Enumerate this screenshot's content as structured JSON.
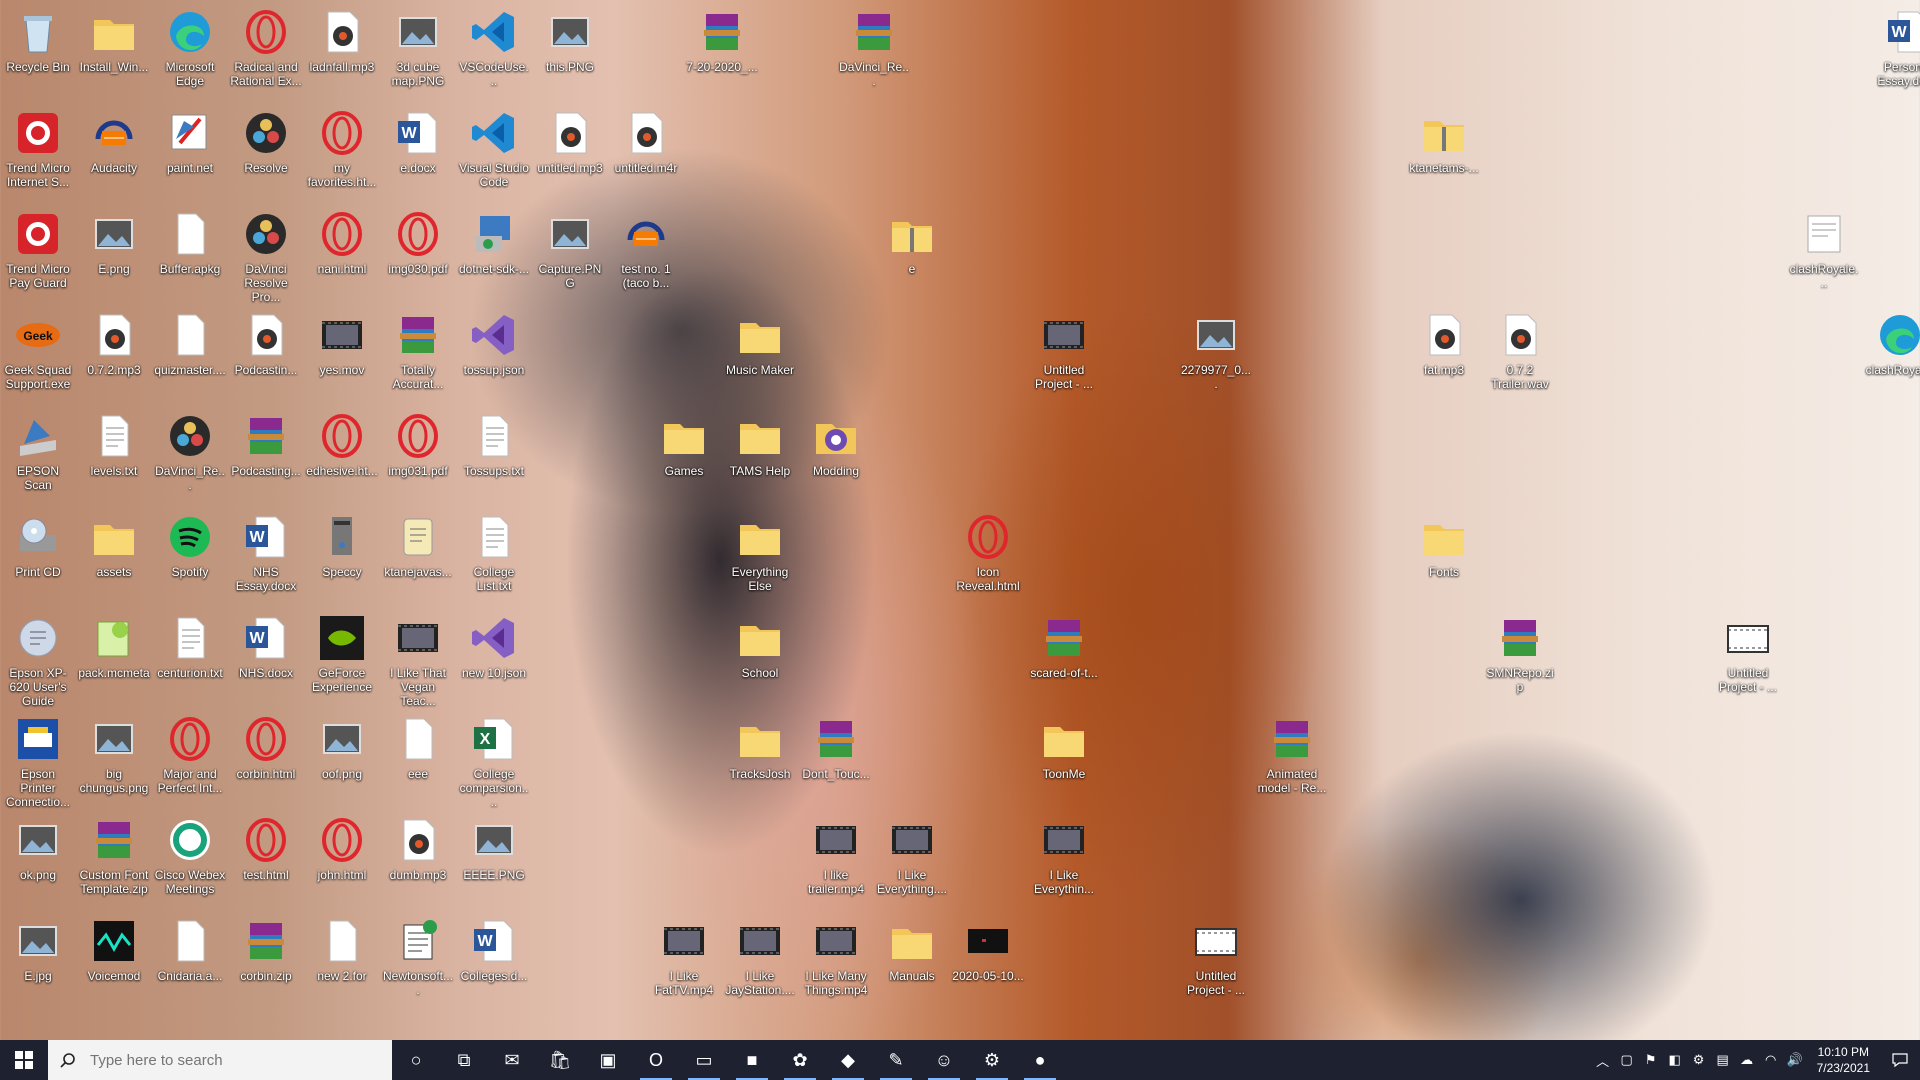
{
  "desktop_icons": [
    {
      "label": "Recycle Bin",
      "icon": "recycle-bin-icon",
      "type": "bin"
    },
    {
      "label": "Install_Win...",
      "icon": "folder-icon",
      "type": "folder"
    },
    {
      "label": "Microsoft Edge",
      "icon": "edge-icon",
      "type": "edge"
    },
    {
      "label": "Radical and Rational Ex...",
      "icon": "opera-icon",
      "type": "opera"
    },
    {
      "label": "ladnfall.mp3",
      "icon": "audio-file-icon",
      "type": "audio"
    },
    {
      "label": "3d cube map.PNG",
      "icon": "image-file-icon",
      "type": "image"
    },
    {
      "label": "VSCodeUse...",
      "icon": "vscode-icon",
      "type": "vscode"
    },
    {
      "label": "this.PNG",
      "icon": "image-file-icon",
      "type": "image"
    },
    {
      "label": "7-20-2020_...",
      "icon": "winrar-archive-icon",
      "type": "rar"
    },
    {
      "label": "DaVinci_Re...",
      "icon": "winrar-archive-icon",
      "type": "rar"
    },
    {
      "label": "Personal Essay.docx",
      "icon": "word-doc-icon",
      "type": "word"
    },
    {
      "label": "Trend Micro Internet S...",
      "icon": "trend-micro-icon",
      "type": "trend"
    },
    {
      "label": "Audacity",
      "icon": "audacity-icon",
      "type": "audacity"
    },
    {
      "label": "paint.net",
      "icon": "paint-net-icon",
      "type": "paint"
    },
    {
      "label": "Resolve",
      "icon": "davinci-resolve-icon",
      "type": "resolve"
    },
    {
      "label": "my favorites.ht...",
      "icon": "opera-icon",
      "type": "opera"
    },
    {
      "label": "e.docx",
      "icon": "word-doc-icon",
      "type": "word"
    },
    {
      "label": "Visual Studio Code",
      "icon": "vscode-icon",
      "type": "vscode"
    },
    {
      "label": "untitled.mp3",
      "icon": "audio-file-icon",
      "type": "audio"
    },
    {
      "label": "untitled.m4r",
      "icon": "audio-file-icon",
      "type": "audio"
    },
    {
      "label": "ktanetams-...",
      "icon": "zip-folder-icon",
      "type": "zipfolder"
    },
    {
      "label": "Trend Micro Pay Guard",
      "icon": "trend-micro-icon",
      "type": "trend"
    },
    {
      "label": "E.png",
      "icon": "image-file-icon",
      "type": "image"
    },
    {
      "label": "Buffer.apkg",
      "icon": "blank-file-icon",
      "type": "blank"
    },
    {
      "label": "DaVinci Resolve Pro...",
      "icon": "davinci-resolve-icon",
      "type": "resolve"
    },
    {
      "label": "nani.html",
      "icon": "opera-icon",
      "type": "opera"
    },
    {
      "label": "img030.pdf",
      "icon": "opera-icon",
      "type": "opera"
    },
    {
      "label": "dotnet-sdk-...",
      "icon": "installer-icon",
      "type": "installer"
    },
    {
      "label": "Capture.PNG",
      "icon": "image-file-icon",
      "type": "image"
    },
    {
      "label": "test no. 1 (taco b...",
      "icon": "audacity-icon",
      "type": "audacity"
    },
    {
      "label": "e",
      "icon": "zip-folder-icon",
      "type": "zipfolder"
    },
    {
      "label": "clashRoyale...",
      "icon": "document-icon",
      "type": "doc"
    },
    {
      "label": "Geek Squad Support.exe",
      "icon": "geek-squad-icon",
      "type": "geek"
    },
    {
      "label": "0.7.2.mp3",
      "icon": "audio-file-icon",
      "type": "audio"
    },
    {
      "label": "quizmaster....",
      "icon": "blank-file-icon",
      "type": "blank"
    },
    {
      "label": "Podcastin...",
      "icon": "audio-file-icon",
      "type": "audio"
    },
    {
      "label": "yes.mov",
      "icon": "video-file-icon",
      "type": "video"
    },
    {
      "label": "Totally Accurat...",
      "icon": "winrar-archive-icon",
      "type": "rar"
    },
    {
      "label": "tossup.json",
      "icon": "visual-studio-icon",
      "type": "vs"
    },
    {
      "label": "Music Maker",
      "icon": "folder-icon",
      "type": "folder"
    },
    {
      "label": "Untitled Project - ...",
      "icon": "video-file-icon",
      "type": "video"
    },
    {
      "label": "2279977_0....",
      "icon": "image-file-icon",
      "type": "image"
    },
    {
      "label": "fat.mp3",
      "icon": "audio-file-icon",
      "type": "audio"
    },
    {
      "label": "0.7.2 Trailer.wav",
      "icon": "audio-file-icon",
      "type": "audio"
    },
    {
      "label": "clashRoyal...",
      "icon": "edge-icon",
      "type": "edge"
    },
    {
      "label": "EPSON Scan",
      "icon": "epson-scan-icon",
      "type": "scan"
    },
    {
      "label": "levels.txt",
      "icon": "text-file-icon",
      "type": "text"
    },
    {
      "label": "DaVinci_Re...",
      "icon": "davinci-resolve-icon",
      "type": "resolve"
    },
    {
      "label": "Podcasting...",
      "icon": "winrar-archive-icon",
      "type": "rar"
    },
    {
      "label": "edhesive.ht...",
      "icon": "opera-icon",
      "type": "opera"
    },
    {
      "label": "img031.pdf",
      "icon": "opera-icon",
      "type": "opera"
    },
    {
      "label": "Tossups.txt",
      "icon": "text-file-icon",
      "type": "text"
    },
    {
      "label": "Games",
      "icon": "folder-icon",
      "type": "folder"
    },
    {
      "label": "TAMS Help",
      "icon": "folder-icon",
      "type": "folder"
    },
    {
      "label": "Modding",
      "icon": "github-icon",
      "type": "github"
    },
    {
      "label": "Print CD",
      "icon": "print-cd-icon",
      "type": "printcd"
    },
    {
      "label": "assets",
      "icon": "folder-icon",
      "type": "folder"
    },
    {
      "label": "Spotify",
      "icon": "spotify-icon",
      "type": "spotify"
    },
    {
      "label": "NHS Essay.docx",
      "icon": "word-doc-icon",
      "type": "word"
    },
    {
      "label": "Speccy",
      "icon": "speccy-icon",
      "type": "speccy"
    },
    {
      "label": "ktanejavas...",
      "icon": "script-file-icon",
      "type": "script"
    },
    {
      "label": "College List.txt",
      "icon": "text-file-icon",
      "type": "text"
    },
    {
      "label": "Everything Else",
      "icon": "folder-icon",
      "type": "folder"
    },
    {
      "label": "Icon Reveal.html",
      "icon": "opera-icon",
      "type": "opera"
    },
    {
      "label": "Fonts",
      "icon": "folder-icon",
      "type": "folder"
    },
    {
      "label": "Epson XP-620 User's Guide",
      "icon": "epson-guide-icon",
      "type": "guide"
    },
    {
      "label": "pack.mcmeta",
      "icon": "notepad-plus-icon",
      "type": "npp"
    },
    {
      "label": "centurion.txt",
      "icon": "text-file-icon",
      "type": "text"
    },
    {
      "label": "NHS.docx",
      "icon": "word-doc-icon",
      "type": "word"
    },
    {
      "label": "GeForce Experience",
      "icon": "geforce-icon",
      "type": "geforce"
    },
    {
      "label": "I Like That Vegan Teac...",
      "icon": "video-file-icon",
      "type": "video"
    },
    {
      "label": "new 10.json",
      "icon": "visual-studio-icon",
      "type": "vs"
    },
    {
      "label": "School",
      "icon": "folder-icon",
      "type": "folder"
    },
    {
      "label": "scared-of-t...",
      "icon": "winrar-archive-icon",
      "type": "rar"
    },
    {
      "label": "SMNRepo.zip",
      "icon": "winrar-archive-icon",
      "type": "rar"
    },
    {
      "label": "Untitled Project - ...",
      "icon": "video-project-icon",
      "type": "project"
    },
    {
      "label": "Epson Printer Connectio...",
      "icon": "epson-connect-icon",
      "type": "connect"
    },
    {
      "label": "big chungus.png",
      "icon": "image-file-icon",
      "type": "image"
    },
    {
      "label": "Major and Perfect Int...",
      "icon": "opera-icon",
      "type": "opera"
    },
    {
      "label": "corbin.html",
      "icon": "opera-icon",
      "type": "opera"
    },
    {
      "label": "oof.png",
      "icon": "image-file-icon",
      "type": "image"
    },
    {
      "label": "eee",
      "icon": "blank-file-icon",
      "type": "blank"
    },
    {
      "label": "College comparsion....",
      "icon": "excel-icon",
      "type": "excel"
    },
    {
      "label": "TracksJosh",
      "icon": "folder-icon",
      "type": "folder"
    },
    {
      "label": "Dont_Touc...",
      "icon": "winrar-archive-icon",
      "type": "rar"
    },
    {
      "label": "ToonMe",
      "icon": "folder-icon",
      "type": "folder"
    },
    {
      "label": "Animated model - Re...",
      "icon": "winrar-archive-icon",
      "type": "rar"
    },
    {
      "label": "ok.png",
      "icon": "image-file-icon",
      "type": "image"
    },
    {
      "label": "Custom Font Template.zip",
      "icon": "winrar-archive-icon",
      "type": "rar"
    },
    {
      "label": "Cisco Webex Meetings",
      "icon": "webex-icon",
      "type": "webex"
    },
    {
      "label": "test.html",
      "icon": "opera-icon",
      "type": "opera"
    },
    {
      "label": "john.html",
      "icon": "opera-icon",
      "type": "opera"
    },
    {
      "label": "dumb.mp3",
      "icon": "audio-file-icon",
      "type": "audio"
    },
    {
      "label": "EEEE.PNG",
      "icon": "image-file-icon",
      "type": "image"
    },
    {
      "label": "I like trailer.mp4",
      "icon": "video-file-icon",
      "type": "video"
    },
    {
      "label": "I Like Everything....",
      "icon": "video-file-icon",
      "type": "video"
    },
    {
      "label": "I Like Everythin...",
      "icon": "video-file-icon",
      "type": "video"
    },
    {
      "label": "E.jpg",
      "icon": "image-file-icon",
      "type": "image"
    },
    {
      "label": "Voicemod",
      "icon": "voicemod-icon",
      "type": "voicemod"
    },
    {
      "label": "Cnidaria.a...",
      "icon": "blank-file-icon",
      "type": "blank"
    },
    {
      "label": "corbin.zip",
      "icon": "winrar-archive-icon",
      "type": "rar"
    },
    {
      "label": "new 2.for",
      "icon": "blank-file-icon",
      "type": "blank"
    },
    {
      "label": "Newtonsoft....",
      "icon": "csharp-file-icon",
      "type": "csharp"
    },
    {
      "label": "Colleges.d...",
      "icon": "word-doc-icon",
      "type": "word"
    },
    {
      "label": "I Like FatTV.mp4",
      "icon": "video-file-icon",
      "type": "video"
    },
    {
      "label": "I Like JayStation....",
      "icon": "video-file-icon",
      "type": "video"
    },
    {
      "label": "I Like Many Things.mp4",
      "icon": "video-file-icon",
      "type": "video"
    },
    {
      "label": "Manuals",
      "icon": "folder-icon",
      "type": "folder"
    },
    {
      "label": "2020-05-10...",
      "icon": "video-file-icon",
      "type": "darkvideo"
    },
    {
      "label": "Untitled Project - ...",
      "icon": "video-project-icon",
      "type": "project"
    }
  ],
  "taskbar": {
    "search_placeholder": "Type here to search",
    "pinned": [
      {
        "name": "cortana-icon",
        "glyph": "○"
      },
      {
        "name": "task-view-icon",
        "glyph": "⧉"
      },
      {
        "name": "mail-icon",
        "glyph": "✉"
      },
      {
        "name": "store-icon",
        "glyph": "🛍"
      },
      {
        "name": "photos-icon",
        "glyph": "▣"
      },
      {
        "name": "opera-icon",
        "glyph": "O"
      },
      {
        "name": "file-explorer-icon",
        "glyph": "▭"
      },
      {
        "name": "minecraft-icon",
        "glyph": "■"
      },
      {
        "name": "paint-3d-icon",
        "glyph": "✿"
      },
      {
        "name": "app-icon",
        "glyph": "◆"
      },
      {
        "name": "notepad-plus-icon",
        "glyph": "✎"
      },
      {
        "name": "discord-icon",
        "glyph": "☺"
      },
      {
        "name": "steam-icon",
        "glyph": "⚙"
      },
      {
        "name": "obs-icon",
        "glyph": "●"
      }
    ],
    "time": "10:10 PM",
    "date": "7/23/2021"
  },
  "colors": {
    "taskbar_bg": "#1e2230",
    "active_underline": "#7fb6ff",
    "opera_red": "#e0262d",
    "word_blue": "#2b579a",
    "vscode_blue": "#1f8ad2",
    "folder_yellow": "#f3c659"
  }
}
